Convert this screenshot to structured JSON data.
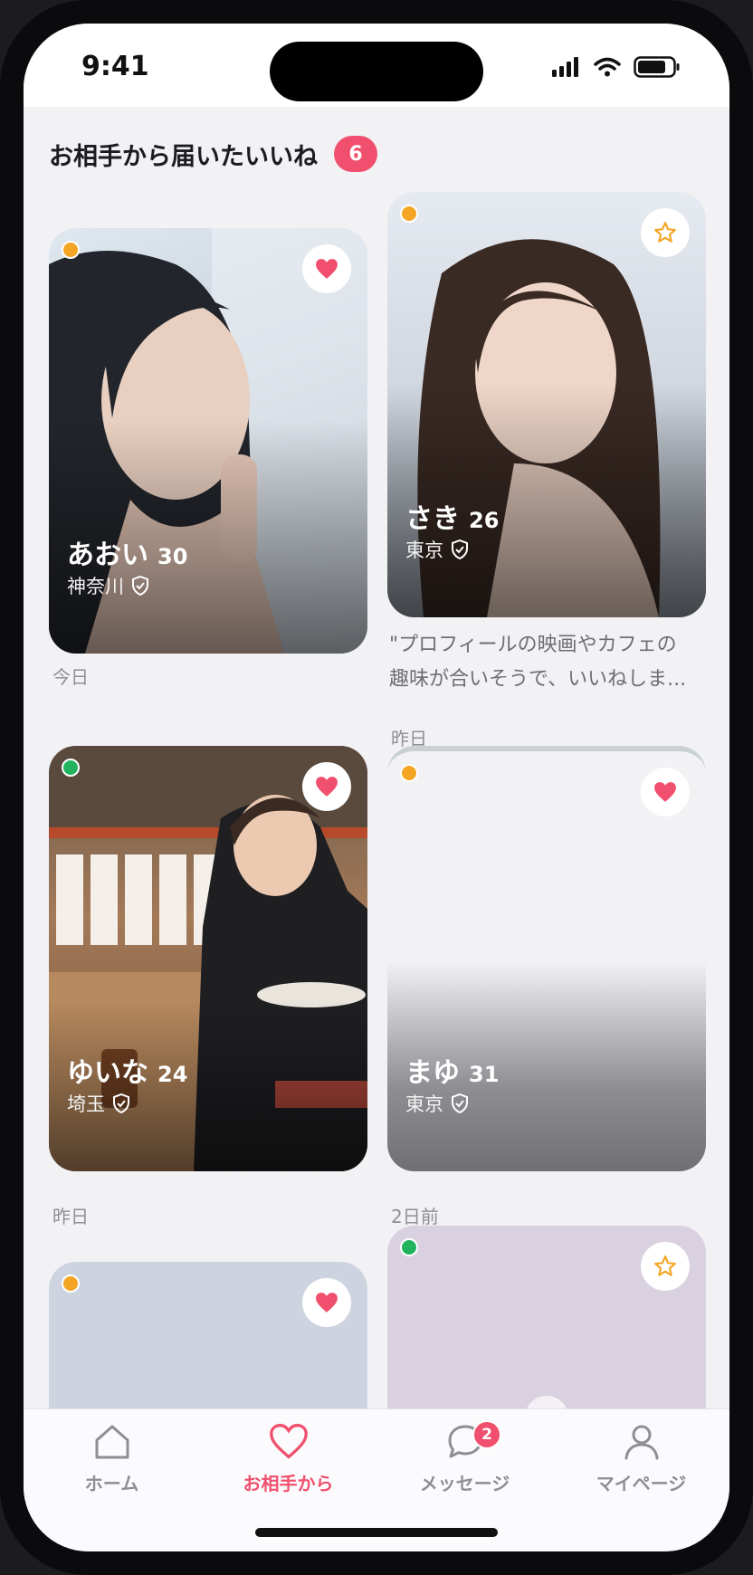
{
  "status_bar": {
    "time": "9:41"
  },
  "header": {
    "title": "お相手から届いたいいね",
    "count": "6"
  },
  "cards": [
    {
      "name": "あおい",
      "age": "30",
      "location": "神奈川",
      "when": "今日",
      "online_color": "#f5a524",
      "fav_icon": "heart-icon"
    },
    {
      "name": "さき",
      "age": "26",
      "location": "東京",
      "when": "昨日",
      "online_color": "#f5a524",
      "fav_icon": "star-icon",
      "message_line1": "\"プロフィールの映画やカフェの",
      "message_line2": "趣味が合いそうで、いいねしま..."
    },
    {
      "name": "ゆいな",
      "age": "24",
      "location": "埼玉",
      "when": "昨日",
      "online_color": "#22b35e",
      "fav_icon": "heart-icon"
    },
    {
      "name": "まゆ",
      "age": "31",
      "location": "東京",
      "when": "2日前",
      "online_color": "#f5a524",
      "fav_icon": "heart-icon"
    },
    {
      "online_color": "#f5a524",
      "fav_icon": "heart-icon"
    },
    {
      "online_color": "#22b35e",
      "fav_icon": "star-icon"
    }
  ],
  "tabs": [
    {
      "label": "ホーム",
      "icon": "home-icon"
    },
    {
      "label": "お相手から",
      "icon": "heart-icon",
      "active": true
    },
    {
      "label": "メッセージ",
      "icon": "chat-bubble-icon",
      "badge": "2"
    },
    {
      "label": "マイページ",
      "icon": "person-icon"
    }
  ],
  "colors": {
    "accent": "#f0506e",
    "star": "#f5a524",
    "online": "#22b35e",
    "away": "#f5a524"
  }
}
